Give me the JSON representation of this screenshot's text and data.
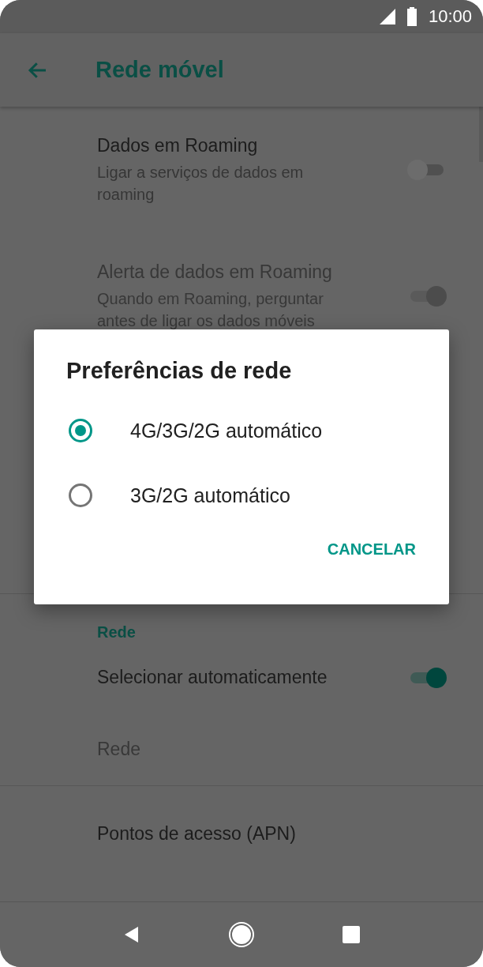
{
  "status_bar": {
    "time": "10:00"
  },
  "app_bar": {
    "title": "Rede móvel"
  },
  "settings": [
    {
      "kind": "switch",
      "title": "Dados em Roaming",
      "summary": "Ligar a serviços de dados em roaming",
      "on": false,
      "disabled": false
    },
    {
      "kind": "switch",
      "title": "Alerta de dados em Roaming",
      "summary": "Quando em Roaming, perguntar antes de ligar os dados móveis",
      "on": true,
      "disabled": true
    }
  ],
  "network_section": {
    "header": "Rede",
    "items": [
      {
        "kind": "switch",
        "title": "Selecionar automaticamente",
        "on": true,
        "disabled": false
      },
      {
        "kind": "plain",
        "title": "Rede",
        "disabled": true
      }
    ]
  },
  "apn_item": {
    "title": "Pontos de acesso (APN)"
  },
  "dialog": {
    "title": "Preferências de rede",
    "options": [
      {
        "label": "4G/3G/2G automático",
        "selected": true
      },
      {
        "label": "3G/2G automático",
        "selected": false
      }
    ],
    "button": "CANCELAR"
  }
}
